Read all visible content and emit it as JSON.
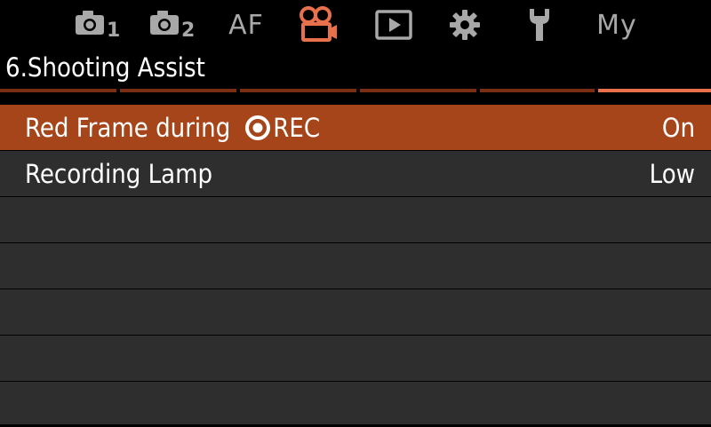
{
  "tabs": [
    {
      "name": "shooting-menu-1",
      "icon": "camera-1-icon",
      "label_sub": "1",
      "active": false
    },
    {
      "name": "shooting-menu-2",
      "icon": "camera-2-icon",
      "label_sub": "2",
      "active": false
    },
    {
      "name": "af-menu",
      "label": "AF",
      "active": false
    },
    {
      "name": "video-menu",
      "icon": "movie-camera-icon",
      "active": true
    },
    {
      "name": "playback-menu",
      "icon": "playback-icon",
      "active": false
    },
    {
      "name": "custom-menu",
      "icon": "gear-icon",
      "active": false
    },
    {
      "name": "setup-menu",
      "icon": "wrench-icon",
      "active": false
    },
    {
      "name": "my-menu",
      "label": "My",
      "active": false
    }
  ],
  "section_title": "6.Shooting Assist",
  "page_indicator": {
    "total": 6,
    "current": 6
  },
  "menu_items": [
    {
      "label": "Red Frame during",
      "label_icon": "record-icon",
      "label_suffix": "REC",
      "value": "On",
      "selected": true
    },
    {
      "label": "Recording Lamp",
      "value": "Low",
      "selected": false
    },
    {
      "label": "",
      "value": ""
    },
    {
      "label": "",
      "value": ""
    },
    {
      "label": "",
      "value": ""
    },
    {
      "label": "",
      "value": ""
    },
    {
      "label": "",
      "value": ""
    }
  ],
  "colors": {
    "accent": "#e8704a",
    "selected_row": "#a6451a",
    "row_bg": "#2e2e2e",
    "inactive_icon": "#a8a8a8",
    "indicator_inactive": "#7a2f14",
    "indicator_active": "#e8704a"
  }
}
